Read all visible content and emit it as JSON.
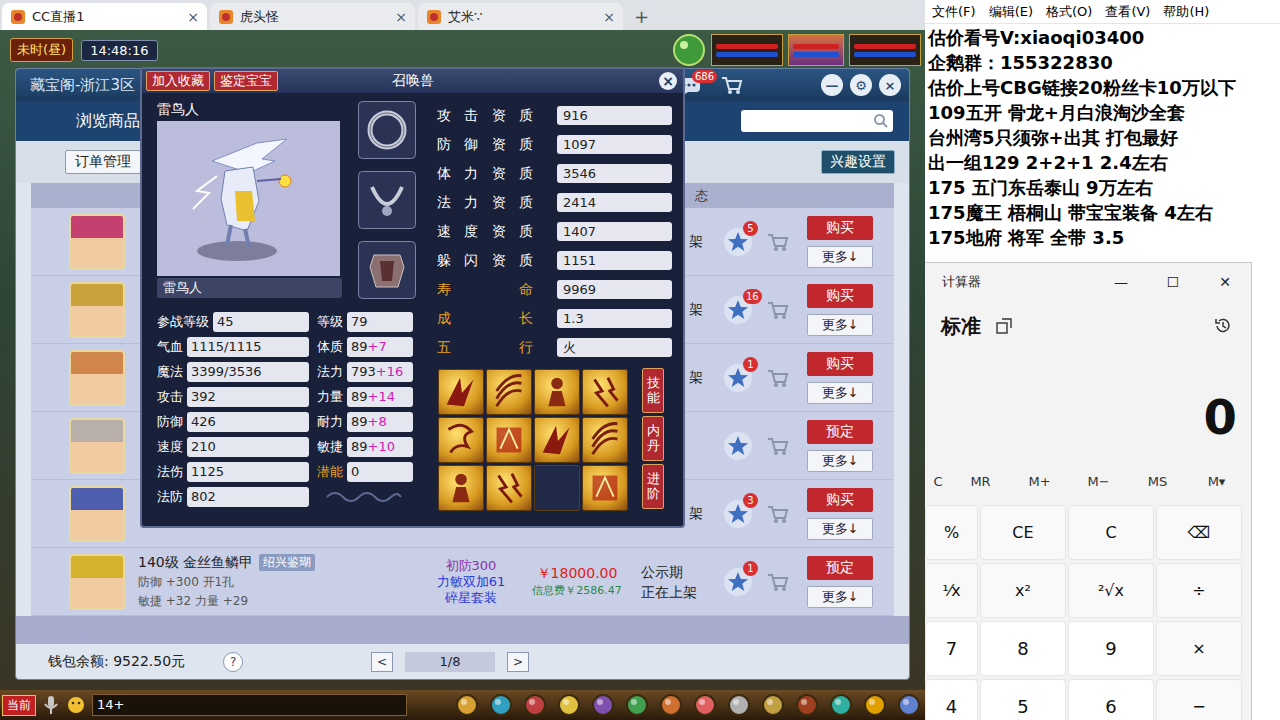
{
  "browser": {
    "tabs": [
      {
        "label": "CC直播1",
        "selected": true,
        "close": "×"
      },
      {
        "label": "虎头怪",
        "selected": false,
        "close": "×"
      },
      {
        "label": "艾米∵",
        "selected": false,
        "close": "×"
      }
    ],
    "new_tab": "+"
  },
  "game": {
    "period": "未时(昼)",
    "clock": "14:48:16",
    "chat_channel": "当前",
    "chat_input": "14+"
  },
  "market": {
    "title": "藏宝阁-浙江3区",
    "mail_badge": "686",
    "controls": [
      "—",
      "⚙",
      "×"
    ],
    "nav": "浏览商品",
    "orders": "订单管理",
    "interests": "兴趣设置",
    "status_header": "态",
    "more": "更多↓",
    "rows": [
      {
        "color": "#c4406e",
        "status": "架",
        "badge": "5",
        "action": "购买"
      },
      {
        "color": "#c9a23c",
        "status": "架",
        "badge": "16",
        "action": "购买"
      },
      {
        "color": "#d0864a",
        "status": "架",
        "badge": "1",
        "action": "购买"
      },
      {
        "color": "#b8b0a8",
        "action": "预定"
      },
      {
        "color": "#4f5fb0",
        "status": "架",
        "badge": "3",
        "action": "购买"
      },
      {
        "color": "#d4b22e",
        "name": "140级 金丝鱼鳞甲",
        "tag": "绍兴鉴瑚",
        "attrs": [
          "防御 +300 开1孔",
          "敏捷 +32 力量 +29"
        ],
        "desc": [
          "初防300",
          "力敏双加61",
          "碎星套装"
        ],
        "price": "￥18000.00",
        "fee": "信息费￥2586.47",
        "status_lines": [
          "公示期",
          "正在上架"
        ],
        "badge": "1",
        "action": "预定"
      }
    ],
    "wallet": "钱包余额: 9522.50元",
    "help": "?",
    "prev": "<",
    "page": "1/8",
    "next": ">"
  },
  "pet": {
    "buttons": [
      "加入收藏",
      "鉴定宝宝"
    ],
    "title": "召唤兽",
    "close": "×",
    "name": "雷鸟人",
    "name_field": "雷鸟人",
    "stats": [
      [
        {
          "label": "参战等级",
          "value": "45",
          "highlight": false
        },
        {
          "label": "等级",
          "value": "79",
          "highlight": false
        }
      ],
      [
        {
          "label": "气血",
          "value": "1115/1115",
          "highlight": false
        },
        {
          "label": "体质",
          "value": "89",
          "bonus": "+7",
          "highlight": false
        }
      ],
      [
        {
          "label": "魔法",
          "value": "3399/3536",
          "highlight": false
        },
        {
          "label": "法力",
          "value": "793",
          "bonus": "+16",
          "highlight": false
        }
      ],
      [
        {
          "label": "攻击",
          "value": "392",
          "highlight": false
        },
        {
          "label": "力量",
          "value": "89",
          "bonus": "+14",
          "highlight": false
        }
      ],
      [
        {
          "label": "防御",
          "value": "426",
          "highlight": false
        },
        {
          "label": "耐力",
          "value": "89",
          "bonus": "+8",
          "highlight": false
        }
      ],
      [
        {
          "label": "速度",
          "value": "210",
          "highlight": false
        },
        {
          "label": "敏捷",
          "value": "89",
          "bonus": "+10",
          "highlight": false
        }
      ],
      [
        {
          "label": "法伤",
          "value": "1125",
          "highlight": false
        },
        {
          "label": "潜能",
          "value": "0",
          "highlight": true
        }
      ],
      [
        {
          "label": "法防",
          "value": "802",
          "highlight": false
        }
      ]
    ],
    "aptitudes": [
      {
        "label": "攻击资质",
        "value": "916",
        "highlight": false
      },
      {
        "label": "防御资质",
        "value": "1097",
        "highlight": false
      },
      {
        "label": "体力资质",
        "value": "3546",
        "highlight": false
      },
      {
        "label": "法力资质",
        "value": "2414",
        "highlight": false
      },
      {
        "label": "速度资质",
        "value": "1407",
        "highlight": false
      },
      {
        "label": "躲闪资质",
        "value": "1151",
        "highlight": false
      },
      {
        "label": "寿命",
        "value": "9969",
        "highlight": true
      },
      {
        "label": "成长",
        "value": "1.3",
        "highlight": true
      },
      {
        "label": "五行",
        "value": "火",
        "highlight": true
      }
    ],
    "skills": [
      {
        "filled": true
      },
      {
        "filled": true
      },
      {
        "filled": true
      },
      {
        "filled": true
      },
      {
        "filled": true
      },
      {
        "filled": true
      },
      {
        "filled": true
      },
      {
        "filled": true
      },
      {
        "filled": true
      },
      {
        "filled": true
      },
      {
        "filled": false
      },
      {
        "filled": true
      }
    ],
    "side_tabs": [
      "技能",
      "内丹",
      "进阶"
    ]
  },
  "notepad": {
    "menu": [
      "文件(F)",
      "编辑(E)",
      "格式(O)",
      "查看(V)",
      "帮助(H)"
    ],
    "lines": [
      "估价看号V:xiaoqi03400",
      "企鹅群：155322830",
      "估价上号CBG链接20粉丝卡10万以下",
      "109五开 骨龙+月白浪淘沙全套",
      "台州湾5只须弥+出其 打包最好",
      "出一组129 2+2+1   2.4左右",
      "175 五门东岳泰山 9万左右",
      "175魔王 梧桐山 带宝宝装备 4左右",
      "175地府 将军 全带 3.5"
    ]
  },
  "calculator": {
    "title": "计算器",
    "controls": [
      "—",
      "☐",
      "✕"
    ],
    "mode": "标准",
    "display": "0",
    "memory": [
      "C",
      "MR",
      "M+",
      "M−",
      "MS",
      "M▾"
    ],
    "keys": [
      [
        {
          "label": "%",
          "kind": "op"
        },
        {
          "label": "CE",
          "kind": "op"
        },
        {
          "label": "C",
          "kind": "op"
        },
        {
          "label": "⌫",
          "kind": "op"
        }
      ],
      [
        {
          "label": "¹⁄x",
          "kind": "op"
        },
        {
          "label": "x²",
          "kind": "op"
        },
        {
          "label": "²√x",
          "kind": "op"
        },
        {
          "label": "÷",
          "kind": "op"
        }
      ],
      [
        {
          "label": "7",
          "kind": "digit"
        },
        {
          "label": "8",
          "kind": "digit"
        },
        {
          "label": "9",
          "kind": "digit"
        },
        {
          "label": "×",
          "kind": "op"
        }
      ],
      [
        {
          "label": "4",
          "kind": "digit"
        },
        {
          "label": "5",
          "kind": "digit"
        },
        {
          "label": "6",
          "kind": "digit"
        },
        {
          "label": "−",
          "kind": "op"
        }
      ]
    ]
  }
}
